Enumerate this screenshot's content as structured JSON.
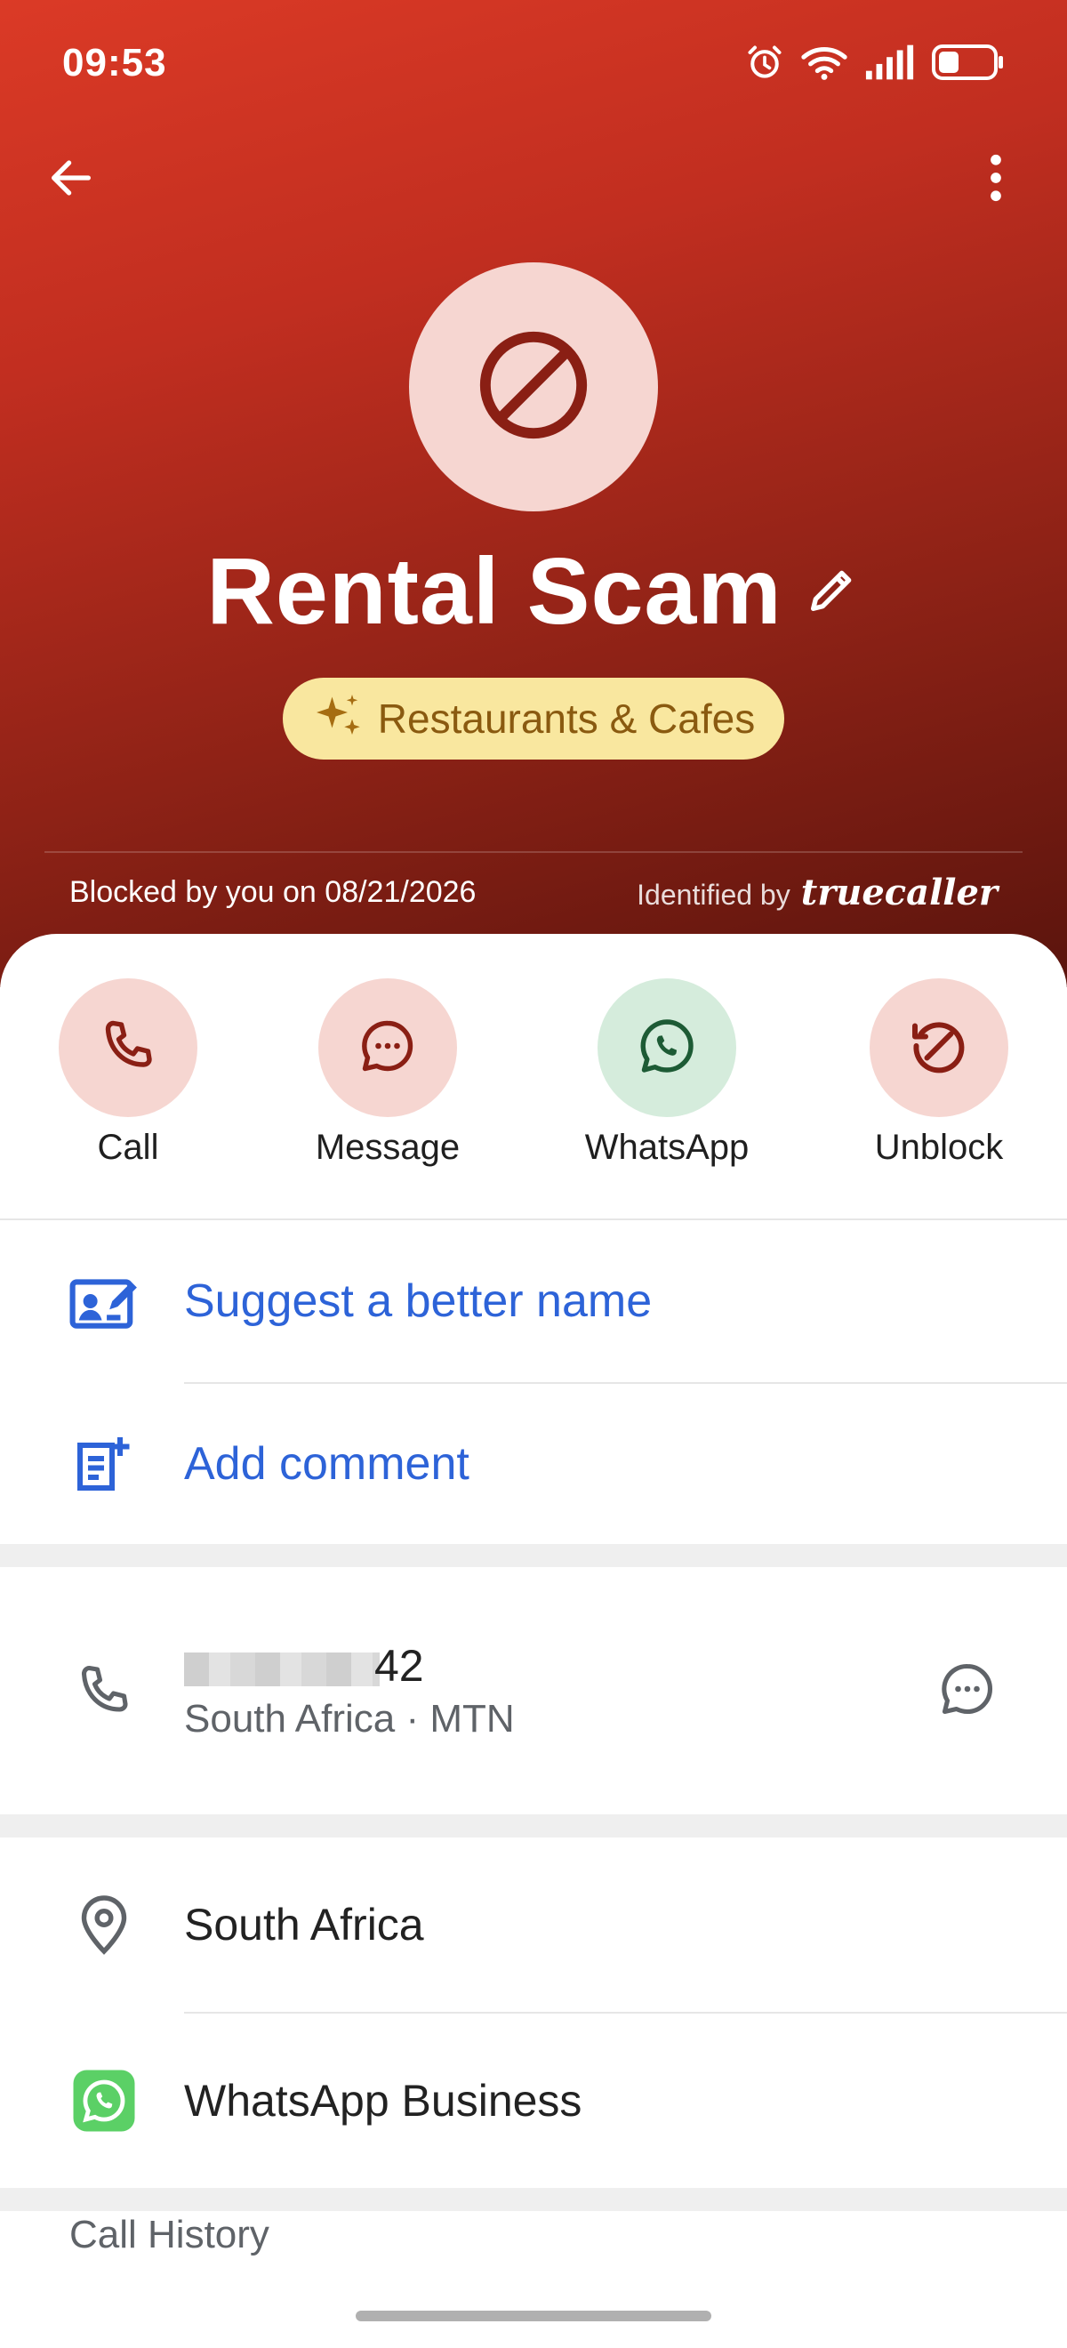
{
  "status_bar": {
    "time": "09:53"
  },
  "contact": {
    "name": "Rental Scam",
    "category": "Restaurants & Cafes",
    "blocked_text": "Blocked by you on 08/21/2026",
    "identified_by": "Identified by",
    "brand": "truecaller"
  },
  "actions": [
    {
      "label": "Call"
    },
    {
      "label": "Message"
    },
    {
      "label": "WhatsApp"
    },
    {
      "label": "Unblock"
    }
  ],
  "options": {
    "suggest_name": "Suggest a better name",
    "add_comment": "Add comment"
  },
  "number": {
    "visible_suffix": "42",
    "location_carrier": "South Africa · MTN"
  },
  "details": {
    "location": "South Africa",
    "whatsapp": "WhatsApp Business"
  },
  "call_history": {
    "title": "Call History"
  },
  "colors": {
    "header_top": "#db3a26",
    "header_bottom": "#5a140d",
    "link_blue": "#2d63d8",
    "category_bg": "#f9e79f",
    "whatsapp_green": "#5bd066"
  },
  "icons": [
    "back-arrow-icon",
    "more-vert-icon",
    "blocked-icon",
    "edit-pencil-icon",
    "sparkle-icon",
    "phone-icon",
    "chat-icon",
    "whatsapp-icon",
    "unblock-icon",
    "suggest-name-icon",
    "add-comment-icon",
    "location-pin-icon",
    "whatsapp-business-icon",
    "alarm-icon",
    "wifi-icon",
    "signal-icon",
    "battery-icon"
  ]
}
